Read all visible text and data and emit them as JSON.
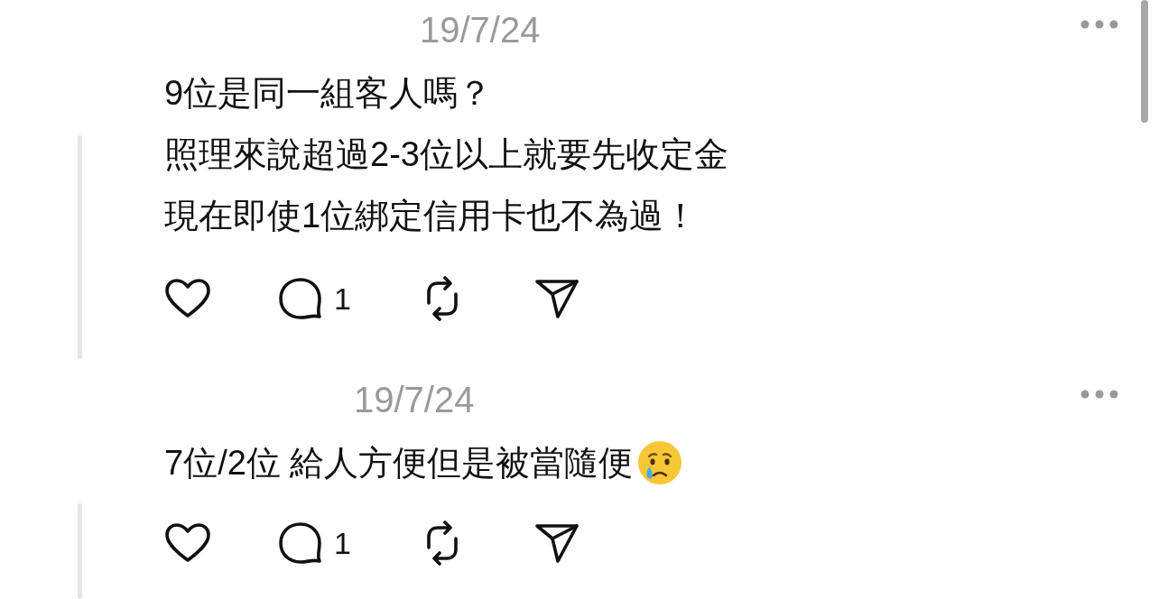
{
  "posts": [
    {
      "date": "19/7/24",
      "lines": [
        "9位是同一組客人嗎？",
        "照理來說超過2-3位以上就要先收定金",
        "現在即使1位綁定信用卡也不為過！"
      ],
      "reply_count": "1",
      "has_emoji": false
    },
    {
      "date": "19/7/24",
      "lines": [
        "7位/2位 給人方便但是被當隨便"
      ],
      "reply_count": "1",
      "has_emoji": true
    }
  ]
}
